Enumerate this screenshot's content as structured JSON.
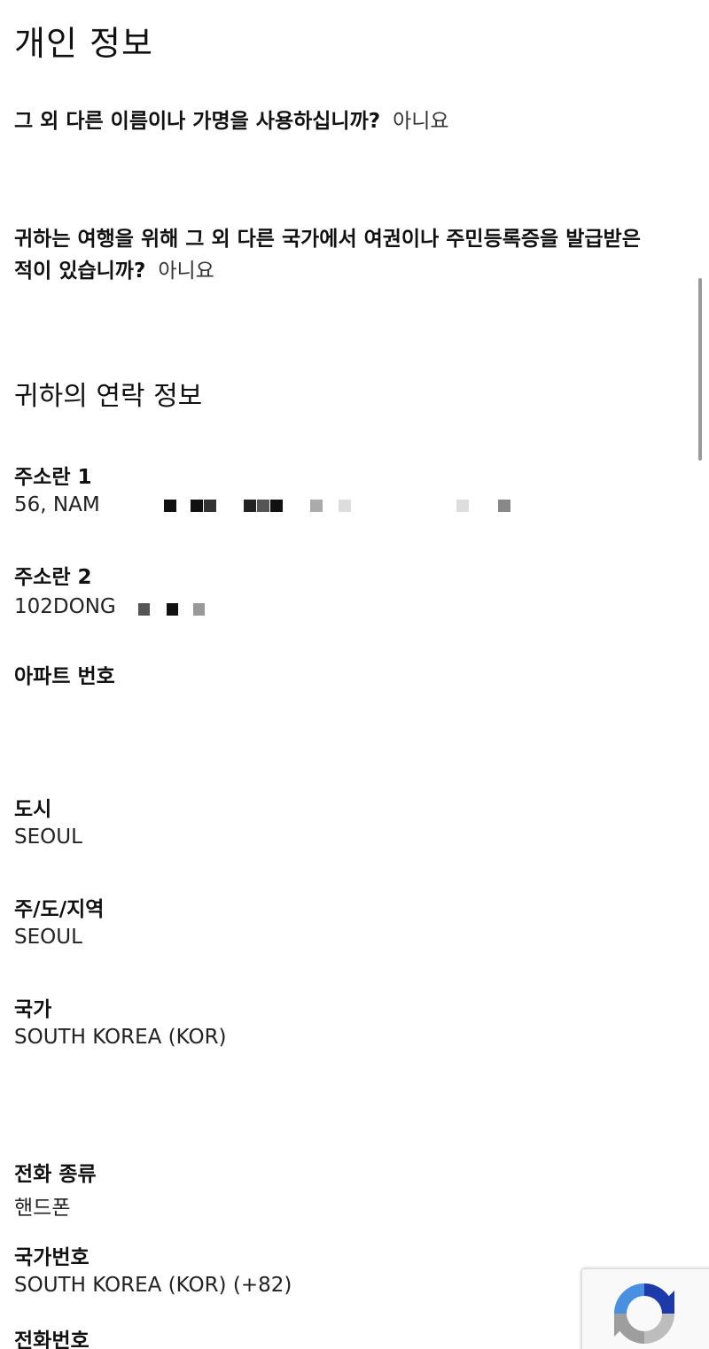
{
  "page": {
    "title": "개인 정보",
    "q1": {
      "question": "그 외 다른 이름이나 가명을 사용하십니까?",
      "answer": "아니요"
    },
    "q2": {
      "question_line1": "귀하는 여행을 위해 그 외 다른 국가에서 여권이나 주민등록증을 발급받은",
      "question_line2": "적이 있습니까?",
      "answer": "아니요"
    }
  },
  "contact": {
    "section_title": "귀하의 연락 정보",
    "address1": {
      "label": "주소란 1",
      "value": "56, NAM"
    },
    "address2": {
      "label": "주소란 2",
      "value": "102DONG"
    },
    "apartment": {
      "label": "아파트 번호",
      "value": ""
    },
    "city": {
      "label": "도시",
      "value": "SEOUL"
    },
    "state": {
      "label": "주/도/지역",
      "value": "SEOUL"
    },
    "country": {
      "label": "국가",
      "value": "SOUTH KOREA (KOR)"
    }
  },
  "phone": {
    "type": {
      "label": "전화 종류",
      "value": "핸드폰"
    },
    "country_code": {
      "label": "국가번호",
      "value": "SOUTH KOREA (KOR) (+82)"
    },
    "number": {
      "label": "전화번호"
    }
  },
  "icons": {
    "recaptcha": "recaptcha-icon"
  },
  "colors": {
    "redaction_dark": "#111111",
    "redaction_mid": "#555555",
    "redaction_light": "#aaaaaa",
    "recaptcha_blue": "#4a90e2"
  }
}
